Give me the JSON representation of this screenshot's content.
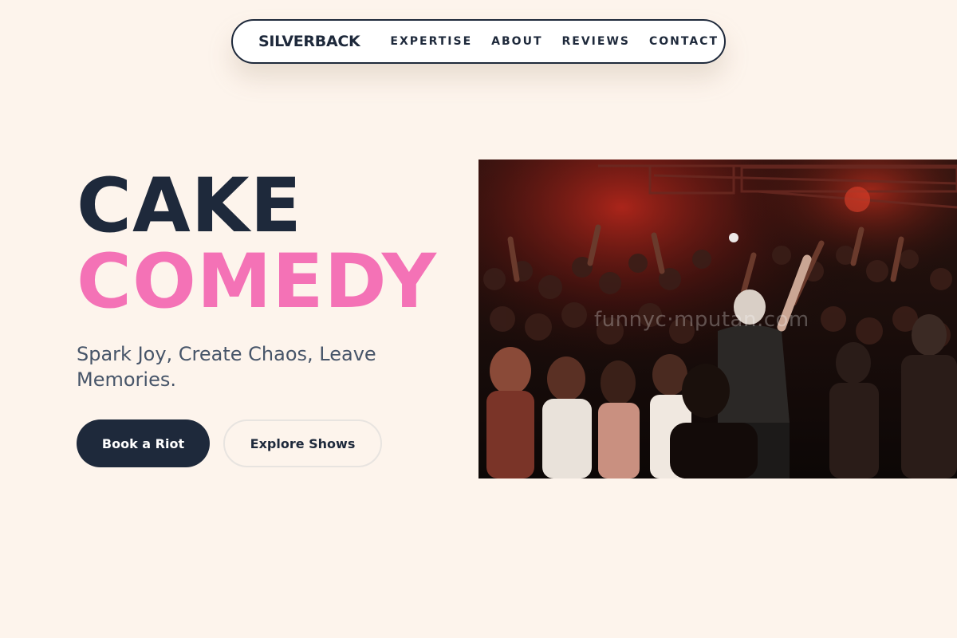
{
  "nav": {
    "brand": "SILVERBACK",
    "links": [
      "EXPERTISE",
      "ABOUT",
      "REVIEWS",
      "CONTACT"
    ]
  },
  "hero": {
    "title_line1": "CAKE",
    "title_line2": "COMEDY",
    "tagline": "Spark Joy, Create Chaos, Leave Memories.",
    "primary_button": "Book a Riot",
    "secondary_button": "Explore Shows",
    "image": {
      "subject": "concert-crowd-performer",
      "watermark": "funnyc·mputan.com"
    }
  },
  "colors": {
    "background": "#fdf4ec",
    "navy": "#1e293b",
    "pink": "#f472b6",
    "tagline": "#475569"
  }
}
